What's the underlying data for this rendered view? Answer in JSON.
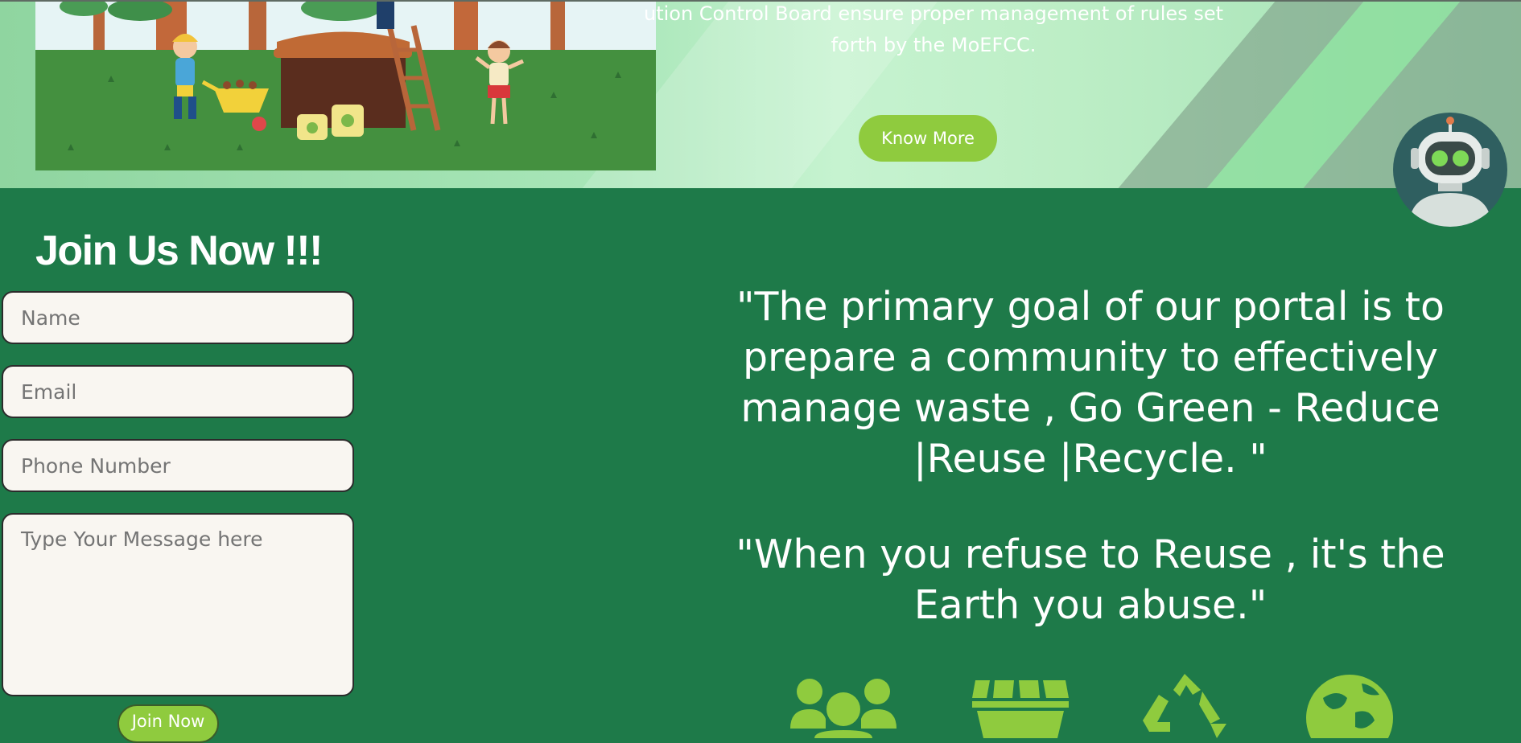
{
  "banner": {
    "text": "ution Control Board ensure proper management of rules set forth by the MoEFCC.",
    "button_label": "Know More"
  },
  "chatbot": {
    "icon": "robot-icon"
  },
  "form": {
    "title": "Join Us Now !!!",
    "name_placeholder": "Name",
    "email_placeholder": "Email",
    "phone_placeholder": "Phone Number",
    "message_placeholder": "Type Your Message here",
    "submit_label": "Join Now"
  },
  "quotes": [
    "\"The primary goal of our portal is to prepare a community to effectively manage waste , Go Green - Reduce |Reuse |Recycle. \"",
    "\"When you refuse to Reuse , it's the Earth you abuse.\""
  ],
  "feature_icons": [
    "community-icon",
    "dumpster-icon",
    "recycle-icon",
    "earth-icon"
  ],
  "colors": {
    "page_bg": "#1e7a49",
    "accent": "#8fcb3e",
    "field_bg": "#f9f6f1"
  }
}
